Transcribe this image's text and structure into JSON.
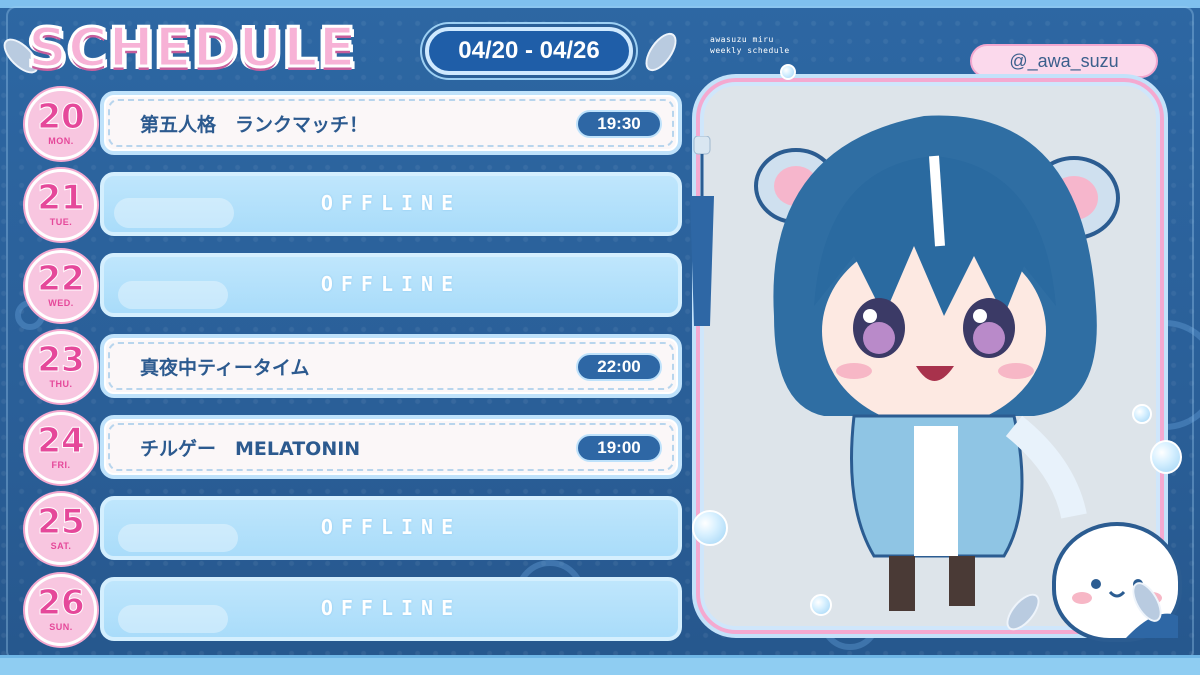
{
  "header": {
    "title": "SCHEDULE",
    "date_range": "04/20 - 04/26",
    "subtitle_line1": "awasuzu miru",
    "subtitle_line2": "weekly schedule",
    "handle": "@_awa_suzu"
  },
  "days": [
    {
      "num": "20",
      "dow": "MON.",
      "status": "event",
      "title": "第五人格　ランクマッチ！",
      "time": "19:30"
    },
    {
      "num": "21",
      "dow": "TUE.",
      "status": "offline",
      "label": "OFFLINE"
    },
    {
      "num": "22",
      "dow": "WED.",
      "status": "offline",
      "label": "OFFLINE"
    },
    {
      "num": "23",
      "dow": "THU.",
      "status": "event",
      "title": "真夜中ティータイム",
      "time": "22:00"
    },
    {
      "num": "24",
      "dow": "FRI.",
      "status": "event",
      "title": "チルゲー　MELATONIN",
      "time": "19:00"
    },
    {
      "num": "25",
      "dow": "SAT.",
      "status": "offline",
      "label": "OFFLINE"
    },
    {
      "num": "26",
      "dow": "SUN.",
      "status": "offline",
      "label": "OFFLINE"
    }
  ],
  "colors": {
    "background": "#2d67a3",
    "accent_pink": "#f8c6e0",
    "day_number": "#e5489a",
    "pill_blue": "#2e67a5",
    "offline_row": "#a9dcfa"
  },
  "icons": [
    "leaf-icon",
    "bubble-icon",
    "tassel-icon",
    "hamster-mascot-icon"
  ]
}
